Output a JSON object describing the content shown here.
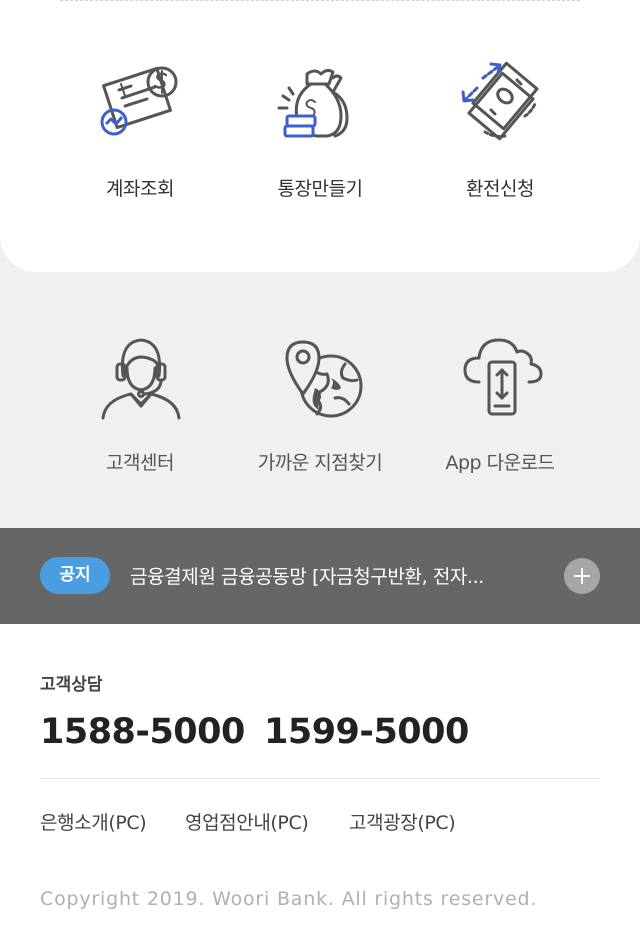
{
  "top_menu": [
    {
      "label": "계좌조회",
      "icon": "account-inquiry-icon"
    },
    {
      "label": "통장만들기",
      "icon": "money-bags-icon"
    },
    {
      "label": "환전신청",
      "icon": "currency-exchange-icon"
    }
  ],
  "lower_menu": [
    {
      "label": "고객센터",
      "icon": "customer-support-icon"
    },
    {
      "label": "가까운 지점찾기",
      "icon": "branch-location-icon"
    },
    {
      "label": "App 다운로드",
      "icon": "app-download-icon"
    }
  ],
  "notice": {
    "badge": "공지",
    "text": "금융결제원 금융공동망 [자금청구반환, 전자...",
    "more_icon": "plus-icon"
  },
  "footer": {
    "cs_label": "고객상담",
    "phones": [
      "1588-5000",
      "1599-5000"
    ],
    "links": [
      "은행소개(PC)",
      "영업점안내(PC)",
      "고객광장(PC)"
    ],
    "copyright": "Copyright 2019. Woori Bank. All rights reserved."
  },
  "colors": {
    "accent_blue": "#4a9de0",
    "icon_gray": "#555555",
    "icon_blue": "#3f5fc8",
    "notice_bg": "#666666",
    "page_bg": "#f0f0f0"
  }
}
